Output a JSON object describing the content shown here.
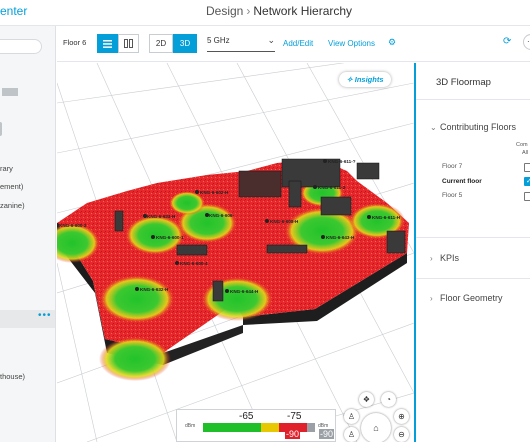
{
  "header": {
    "app_title_fragment": "enter",
    "breadcrumb_parent": "Design",
    "breadcrumb_current": "Network Hierarchy"
  },
  "sidebar": {
    "tree_items": [
      "rary",
      "ement)",
      "zanine)",
      "thouse)"
    ],
    "more_icon": "ellipsis-icon"
  },
  "toolbar": {
    "floor_label": "Floor 6",
    "view_list_icon": "list-icon",
    "view_split_icon": "columns-icon",
    "mode_2d": "2D",
    "mode_3d": "3D",
    "band_value": "5 GHz",
    "add_edit": "Add/Edit",
    "view_options": "View Options",
    "settings_icon": "gear-icon",
    "refresh_icon": "refresh-icon"
  },
  "map": {
    "insights_label": "Insights",
    "ap_labels": [
      "KNG-6-611-?",
      "KNG-6-602-H",
      "KNG-6-611-2",
      "KNG-6-633-H",
      "KNG-6-600-2",
      "KNG-6-600-1",
      "KNG-6-606-",
      "KNG-6-608-H",
      "KNG-6-611-H",
      "KNG-6-643-H",
      "KNG-6-600-4",
      "KNG-6-632-H",
      "KNG-6-644-H"
    ],
    "legend": {
      "unit": "dBm",
      "values": [
        "-65",
        "-75",
        "-90",
        "-90"
      ]
    },
    "colors": {
      "strong": "#1fbf2a",
      "medium": "#e8e000",
      "weak": "#e0202a",
      "wall": "#3a3a3a"
    }
  },
  "right_panel": {
    "title": "3D Floormap",
    "contributing_floors": "Contributing Floors",
    "column_header_line1": "Com",
    "column_header_line2": "All",
    "floors": [
      {
        "name": "Floor 7",
        "checked": false
      },
      {
        "name": "Current floor",
        "checked": true
      },
      {
        "name": "Floor 5",
        "checked": false
      }
    ],
    "kpis": "KPIs",
    "floor_geometry": "Floor Geometry"
  },
  "accent_color": "#049fd9"
}
